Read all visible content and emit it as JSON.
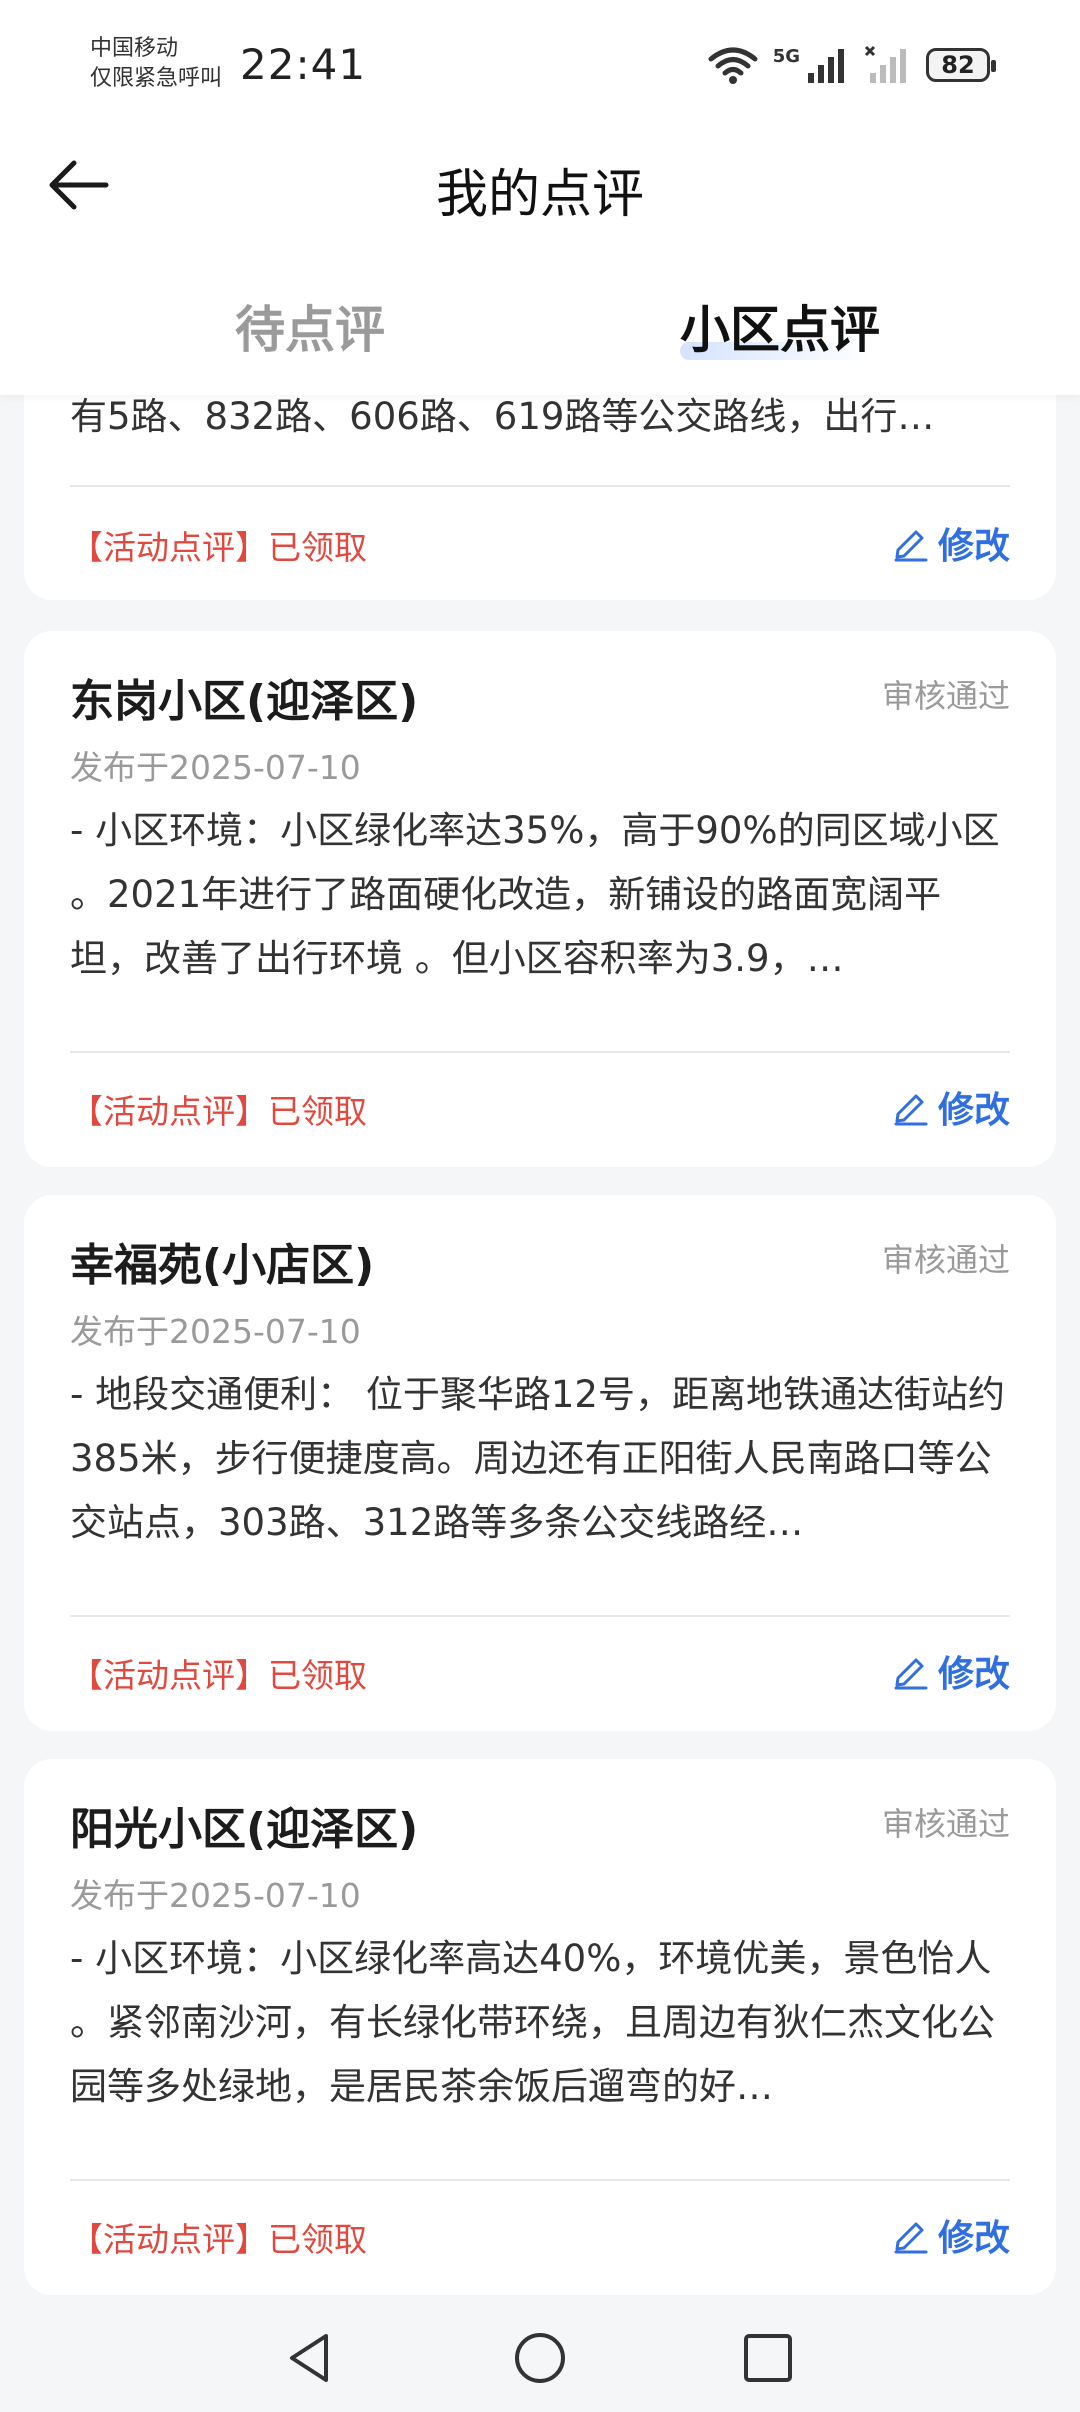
{
  "status_bar": {
    "carrier_line1": "中国移动",
    "carrier_line2": "仅限紧急呼叫",
    "time": "22:41",
    "network": "5G",
    "battery": "82"
  },
  "header": {
    "title": "我的点评"
  },
  "tabs": [
    {
      "label": "待点评",
      "active": false
    },
    {
      "label": "小区点评",
      "active": true
    }
  ],
  "partial_card": {
    "body_tail": "有5路、832路、606路、619路等公交路线，出行…",
    "tag": "【活动点评】已领取",
    "edit_label": "修改"
  },
  "reviews": [
    {
      "name": "东岗小区(迎泽区)",
      "status": "审核通过",
      "date": "发布于2025-07-10",
      "body": "- 小区环境：小区绿化率达35%，高于90%的同区域小区 。2021年进行了路面硬化改造，新铺设的路面宽阔平坦，改善了出行环境 。但小区容积率为3.9，…",
      "tag": "【活动点评】已领取",
      "edit_label": "修改"
    },
    {
      "name": "幸福苑(小店区)",
      "status": "审核通过",
      "date": "发布于2025-07-10",
      "body": "- 地段交通便利： 位于聚华路12号，距离地铁通达街站约385米，步行便捷度高。周边还有正阳街人民南路口等公交站点，303路、312路等多条公交线路经…",
      "tag": "【活动点评】已领取",
      "edit_label": "修改"
    },
    {
      "name": "阳光小区(迎泽区)",
      "status": "审核通过",
      "date": "发布于2025-07-10",
      "body": "- 小区环境：小区绿化率高达40%，环境优美，景色怡人 。紧邻南沙河，有长绿化带环绕，且周边有狄仁杰文化公园等多处绿地，是居民茶余饭后遛弯的好…",
      "tag": "【活动点评】已领取",
      "edit_label": "修改"
    }
  ],
  "colors": {
    "accent": "#2f6fe0",
    "tag": "#e2483d",
    "muted": "#9a9a9a"
  }
}
